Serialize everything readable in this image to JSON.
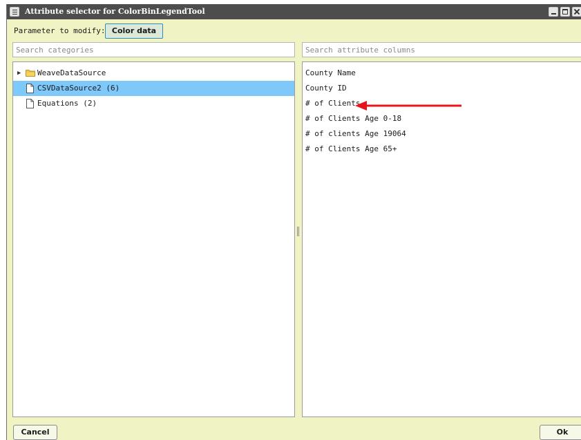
{
  "window": {
    "title": "Attribute selector for ColorBinLegendTool"
  },
  "parameter": {
    "label": "Parameter to modify:",
    "button_label": "Color data"
  },
  "categories": {
    "search_placeholder": "Search categories",
    "items": [
      {
        "label": "WeaveDataSource",
        "icon": "folder-icon",
        "expandable": true,
        "selected": false
      },
      {
        "label": "CSVDataSource2 (6)",
        "icon": "file-icon",
        "expandable": false,
        "selected": true
      },
      {
        "label": "Equations (2)",
        "icon": "file-icon",
        "expandable": false,
        "selected": false
      }
    ]
  },
  "attributes": {
    "search_placeholder": "Search attribute columns",
    "items": [
      {
        "label": "County Name"
      },
      {
        "label": "County ID"
      },
      {
        "label": "# of Clients"
      },
      {
        "label": "# of Clients Age 0-18"
      },
      {
        "label": "# of clients Age 19064"
      },
      {
        "label": "# of Clients Age 65+"
      }
    ]
  },
  "footer": {
    "cancel_label": "Cancel",
    "ok_label": "Ok"
  },
  "colors": {
    "titlebar": "#4d4d4d",
    "window_bg": "#f0f3c4",
    "selected_row": "#7fc8fa",
    "annotation_arrow": "#e8141c"
  }
}
